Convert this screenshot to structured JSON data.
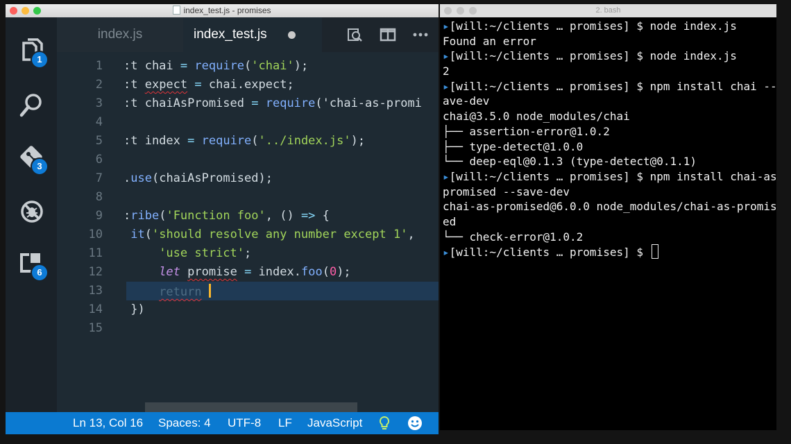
{
  "editor": {
    "window_title": "index_test.js - promises",
    "activity": [
      {
        "icon": "explorer-icon",
        "badge": "1"
      },
      {
        "icon": "search-icon",
        "badge": ""
      },
      {
        "icon": "git-icon",
        "badge": "3"
      },
      {
        "icon": "debug-icon",
        "badge": ""
      },
      {
        "icon": "extensions-icon",
        "badge": "6"
      }
    ],
    "tabs": [
      {
        "label": "index.js",
        "active": false
      },
      {
        "label": "index_test.js",
        "active": true,
        "dirty": true
      }
    ],
    "tab_actions": [
      "open-changes-icon",
      "split-editor-icon",
      "more-actions-icon"
    ],
    "lines": [
      {
        "n": "1",
        "code": ":t chai = require('chai');"
      },
      {
        "n": "2",
        "code": ":t expect = chai.expect;"
      },
      {
        "n": "3",
        "code": ":t chaiAsPromised = require('chai-as-promi"
      },
      {
        "n": "4",
        "code": ""
      },
      {
        "n": "5",
        "code": ":t index = require('../index.js');"
      },
      {
        "n": "6",
        "code": ""
      },
      {
        "n": "7",
        "code": ".use(chaiAsPromised);"
      },
      {
        "n": "8",
        "code": ""
      },
      {
        "n": "9",
        "code": ":ribe('Function foo', () => {"
      },
      {
        "n": "10",
        "code": " it('should resolve any number except 1',"
      },
      {
        "n": "11",
        "code": "     'use strict';"
      },
      {
        "n": "12",
        "code": "     let promise = index.foo(0);"
      },
      {
        "n": "13",
        "code": "     return "
      },
      {
        "n": "14",
        "code": " })"
      },
      {
        "n": "15",
        "code": ""
      }
    ],
    "current_line": 13,
    "status": {
      "position": "Ln 13, Col 16",
      "spaces": "Spaces: 4",
      "encoding": "UTF-8",
      "eol": "LF",
      "language": "JavaScript",
      "icons": [
        "lightbulb-icon",
        "smiley-icon"
      ]
    },
    "colors": {
      "statusbar": "#0b7ad1",
      "background": "#1e2a33",
      "badge": "#0e7bd6",
      "caret": "#f7b52e"
    }
  },
  "terminal": {
    "title": "2. bash",
    "lines": [
      {
        "prompt": true,
        "text": "[will:~/clients … promises] $ node index.js"
      },
      {
        "prompt": false,
        "text": "Found an error"
      },
      {
        "prompt": true,
        "text": "[will:~/clients … promises] $ node index.js"
      },
      {
        "prompt": false,
        "text": "2"
      },
      {
        "prompt": true,
        "text": "[will:~/clients … promises] $ npm install chai --s"
      },
      {
        "prompt": false,
        "text": "ave-dev"
      },
      {
        "prompt": false,
        "text": "chai@3.5.0 node_modules/chai"
      },
      {
        "prompt": false,
        "text": "├── assertion-error@1.0.2"
      },
      {
        "prompt": false,
        "text": "├── type-detect@1.0.0"
      },
      {
        "prompt": false,
        "text": "└── deep-eql@0.1.3 (type-detect@0.1.1)"
      },
      {
        "prompt": true,
        "text": "[will:~/clients … promises] $ npm install chai-as-"
      },
      {
        "prompt": false,
        "text": "promised --save-dev"
      },
      {
        "prompt": false,
        "text": "chai-as-promised@6.0.0 node_modules/chai-as-promis"
      },
      {
        "prompt": false,
        "text": "ed"
      },
      {
        "prompt": false,
        "text": "└── check-error@1.0.2"
      },
      {
        "prompt": true,
        "text": "[will:~/clients … promises] $ ",
        "cursor": true
      }
    ],
    "colors": {
      "prompt_marker": "#3b8ed8",
      "background": "#000000",
      "text": "#f2f2f2"
    }
  }
}
